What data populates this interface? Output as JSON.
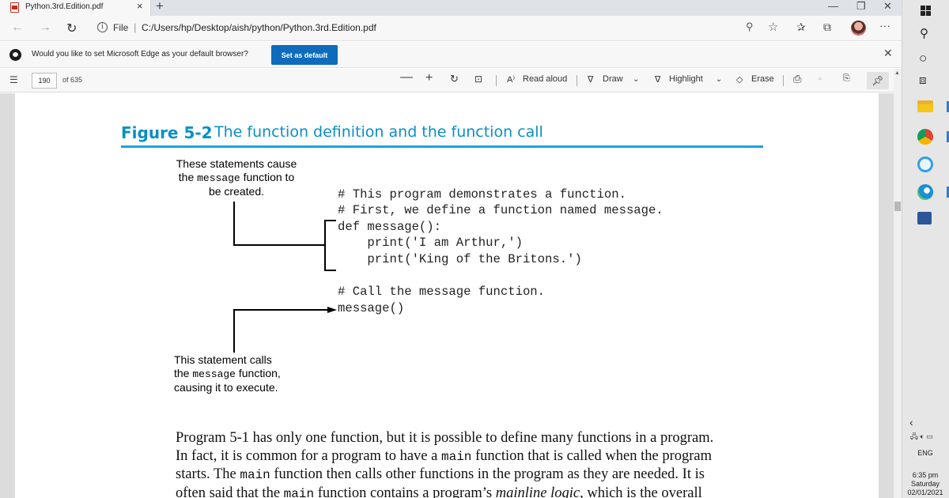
{
  "browser": {
    "tab_title": "Python.3rd.Edition.pdf",
    "tab_close": "×",
    "new_tab": "+",
    "window_min": "—",
    "window_restore": "❐",
    "window_close": "✕",
    "address": {
      "scheme_label": "File",
      "url": "C:/Users/hp/Desktop/aish/python/Python.3rd.Edition.pdf"
    },
    "icons": [
      "back-icon",
      "forward-icon",
      "refresh-icon",
      "info-icon",
      "zoom-icon",
      "favorite-star-icon",
      "favorites-icon",
      "collections-icon",
      "profile-avatar",
      "more-icon"
    ],
    "more": "···"
  },
  "infobar": {
    "message": "Would you like to set Microsoft Edge as your default browser?",
    "button": "Set as default",
    "close": "✕"
  },
  "pdf_toolbar": {
    "page_current": "190",
    "page_total": "of 635",
    "zoom_out": "—",
    "zoom_in": "+",
    "read_aloud": "Read aloud",
    "draw": "Draw",
    "highlight": "Highlight",
    "erase": "Erase"
  },
  "document": {
    "figure_label": "Figure 5-2",
    "figure_caption": "The function definition and the function call",
    "callout_top": {
      "line1": "These statements cause",
      "line2_pre": "the ",
      "line2_code": "message",
      "line2_post": " function to",
      "line3": "be created."
    },
    "callout_bottom": {
      "line1": "This statement calls",
      "line2_pre": "the ",
      "line2_code": "message",
      "line2_post": " function,",
      "line3": "causing it to execute."
    },
    "code_lines": [
      "# This program demonstrates a function.",
      "# First, we define a function named message.",
      "def message():",
      "    print('I am Arthur,')",
      "    print('King of the Britons.')",
      "",
      "# Call the message function.",
      "message()"
    ],
    "paragraph": {
      "l1": "Program 5-1 has only one function, but it is possible to define many functions in a program.",
      "l2_a": "In fact, it is common for a program to have a ",
      "l2_code": "main",
      "l2_b": " function that is called when the program",
      "l3_a": "starts. The ",
      "l3_code": "main",
      "l3_b": " function then calls other functions in the program as they are needed. It is",
      "l4_a": "often said that the ",
      "l4_code": "main",
      "l4_b": " function contains a program’s ",
      "l4_italic": "mainline logic",
      "l4_c": ", which is the overall"
    }
  },
  "taskbar": {
    "language": "ENG",
    "time": "6:35 pm",
    "day": "Saturday",
    "date": "02/01/2021"
  }
}
